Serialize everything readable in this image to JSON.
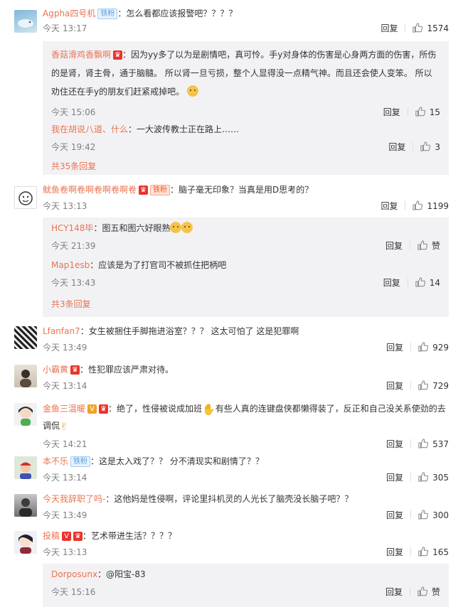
{
  "comments": [
    {
      "user": "Agpha四号机",
      "badge": "铁粉",
      "text": "：怎么看都应该报警吧？？？？",
      "time": "今天 13:17",
      "reply": "回复",
      "likes": "1574",
      "replies": [
        {
          "user": "香菇滑鸡香飘啊",
          "badge_icon": "crown-badge",
          "text_1": "：因为yy多了以为是剧情吧，真可怜。手y对身体的伤害是心身两方面的伤害，所伤",
          "text_2": "的是肾，肾主骨，通于脑髓。 所以肾一旦亏损，整个人显得没一点精气神。而且还会使人变笨。 所以",
          "text_3": "劝住还在手y的朋友们赶紧戒掉吧。",
          "time": "今天 15:06",
          "reply": "回复",
          "likes": "15"
        },
        {
          "user": "我在胡说八道、什么",
          "text": "：一大波传教士正在路上……",
          "time": "今天 19:42",
          "reply": "回复",
          "likes": "3"
        }
      ],
      "more": "共35条回复"
    },
    {
      "user": "鱿鱼卷啊卷啊卷啊卷啊卷",
      "badge": "铁粉",
      "text": "：脑子毫无印象？当真是用D思考的？",
      "time": "今天 13:13",
      "reply": "回复",
      "likes": "1199",
      "replies": [
        {
          "user": "HCY148毕",
          "text": "：图五和图六好眼熟",
          "time": "今天 21:39",
          "reply": "回复",
          "likes": "赞"
        },
        {
          "user": "Map1esb",
          "text": "：应该是为了打官司不被抓住把柄吧",
          "time": "今天 13:43",
          "reply": "回复",
          "likes": "14"
        }
      ],
      "more": "共3条回复"
    },
    {
      "user": "Lfanfan7",
      "text": "：女生被捆住手脚拖进浴室？？？ 这太可怕了 这是犯罪啊",
      "time": "今天 13:49",
      "reply": "回复",
      "likes": "929"
    },
    {
      "user": "小霸黄",
      "text": "：性犯罪应该严肃对待。",
      "time": "今天 13:14",
      "reply": "回复",
      "likes": "729"
    },
    {
      "user": "金鱼三温暖",
      "text_1": "：绝了，性侵被说成加班",
      "text_2": "有些人真的连键盘侠都懒得装了，反正和自己没关系使劲的去",
      "text_3": "调侃",
      "time": "今天 14:21",
      "reply": "回复",
      "likes": "537"
    },
    {
      "user": "本不乐",
      "badge": "铁粉",
      "text": "：这是太入戏了？？ 分不清现实和剧情了？？",
      "time": "今天 13:14",
      "reply": "回复",
      "likes": "305"
    },
    {
      "user": "今天我辞职了吗-",
      "text": "：这他妈是性侵啊，评论里抖机灵的人光长了脑壳没长脑子吧？？",
      "time": "今天 13:49",
      "reply": "回复",
      "likes": "300"
    },
    {
      "user": "投稿",
      "text": "：艺术带进生活？？？？",
      "time": "今天 13:13",
      "reply": "回复",
      "likes": "165",
      "replies": [
        {
          "user": "Dorposunx",
          "text": "：@阳宝-83",
          "time": "今天 15:16",
          "reply": "回复",
          "likes": "赞"
        }
      ]
    }
  ],
  "colors": {
    "username": "#eb7350",
    "reply_bg": "#f2f2f5",
    "time": "#808080"
  }
}
